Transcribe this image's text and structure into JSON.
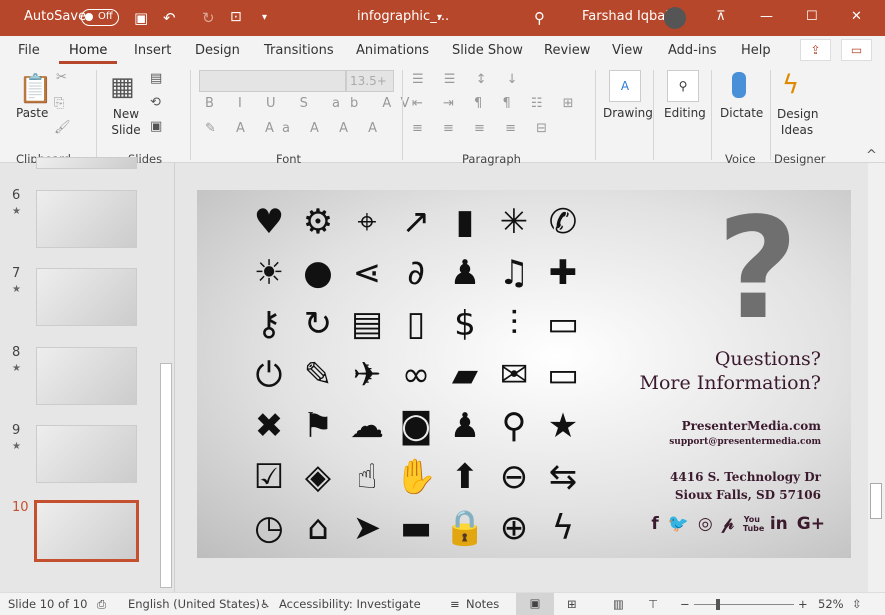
{
  "titlebar": {
    "autosave": "AutoSave",
    "toggle": "Off",
    "filename": "infographic_...",
    "user": "Farshad Iqbal"
  },
  "tabs": [
    "File",
    "Home",
    "Insert",
    "Design",
    "Transitions",
    "Animations",
    "Slide Show",
    "Review",
    "View",
    "Add-ins",
    "Help"
  ],
  "ribbon": {
    "paste": "Paste",
    "new_slide": "New Slide",
    "font_size": "13.5+",
    "drawing": "Drawing",
    "editing": "Editing",
    "dictate": "Dictate",
    "design_ideas": "Design Ideas",
    "groups": [
      "Clipboard",
      "Slides",
      "Font",
      "Paragraph",
      "Voice",
      "Designer"
    ]
  },
  "thumbnails": [
    {
      "num": "6",
      "star": "★"
    },
    {
      "num": "7",
      "star": "★"
    },
    {
      "num": "8",
      "star": "★"
    },
    {
      "num": "9",
      "star": "★"
    },
    {
      "num": "10",
      "star": ""
    }
  ],
  "slide": {
    "icons": [
      "heart",
      "gear",
      "map-pin",
      "growth-chart",
      "bar-chart",
      "loading",
      "phone",
      "lightbulb",
      "speech-bubble",
      "share",
      "pen-link",
      "user",
      "music",
      "puzzle",
      "key",
      "refresh",
      "document-lines",
      "tablet",
      "dollar",
      "sliders",
      "file",
      "power",
      "pencil",
      "airplane",
      "chain-link",
      "folder-open",
      "envelope",
      "monitor",
      "close-x",
      "flag",
      "cloud",
      "camera",
      "users",
      "search",
      "star",
      "checkbox",
      "layers",
      "hand-pointer",
      "thumbs-up",
      "arrow-up",
      "zoom-out",
      "repeat",
      "clock",
      "home",
      "paper-plane",
      "truck",
      "lock",
      "zoom-in",
      "lightning"
    ],
    "glyphs": [
      "♥",
      "⚙",
      "⌖",
      "↗",
      "▮",
      "✳",
      "✆",
      "☀",
      "●",
      "⋖",
      "∂",
      "♟",
      "♫",
      "✚",
      "⚷",
      "↻",
      "▤",
      "▯",
      "$",
      "⫶",
      "▭",
      "⏻",
      "✎",
      "✈",
      "∞",
      "▰",
      "✉",
      "▭",
      "✖",
      "⚑",
      "☁",
      "◙",
      "♟",
      "⚲",
      "★",
      "☑",
      "◈",
      "☝",
      "✋",
      "⬆",
      "⊖",
      "⇆",
      "◷",
      "⌂",
      "➤",
      "▬",
      "🔒",
      "⊕",
      "ϟ"
    ],
    "question": "Questions?",
    "more_info": "More Information?",
    "website": "PresenterMedia.com",
    "email": "support@presentermedia.com",
    "address1": "4416 S. Technology Dr",
    "address2": "Sioux Falls, SD 57106",
    "social": [
      "f",
      "🐦",
      "◎",
      "𝓅",
      "You Tube",
      "in",
      "G+"
    ],
    "social_names": [
      "facebook",
      "twitter",
      "instagram",
      "pinterest",
      "youtube",
      "linkedin",
      "google-plus"
    ]
  },
  "status": {
    "slide": "Slide 10 of 10",
    "language": "English (United States)",
    "accessibility": "Accessibility: Investigate",
    "notes": "Notes",
    "zoom": "52%"
  },
  "colors": {
    "accent": "#b7472a",
    "slide_text": "#3b1a2e"
  }
}
